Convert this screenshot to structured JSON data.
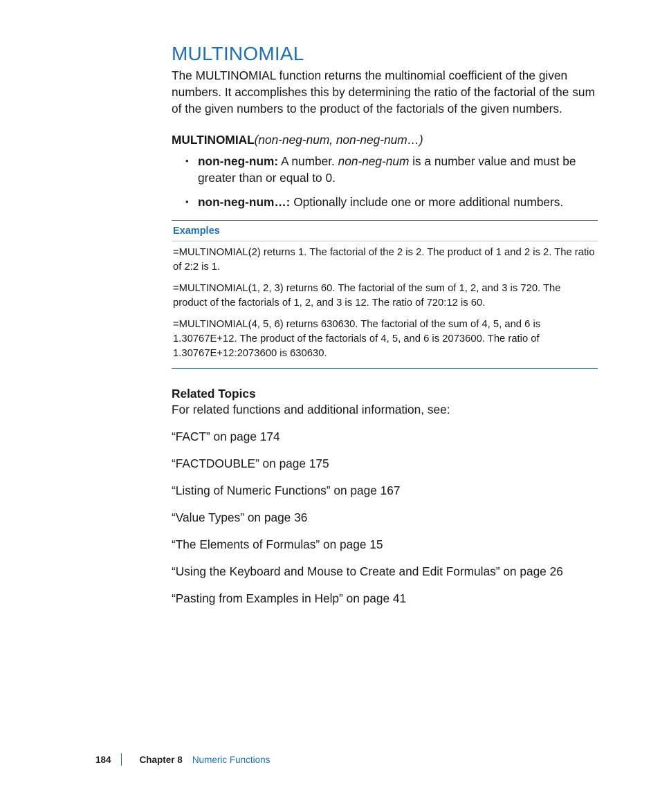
{
  "title": "MULTINOMIAL",
  "intro": "The MULTINOMIAL function returns the multinomial coefficient of the given numbers. It accomplishes this by determining the ratio of the factorial of the sum of the given numbers to the product of the factorials of the given numbers.",
  "syntax": {
    "func_name": "MULTINOMIAL",
    "args": "(non-neg-num, non-neg-num…)"
  },
  "params": [
    {
      "name": "non-neg-num:",
      "text_before_ital": "  A number. ",
      "ital": "non-neg-num",
      "text_after_ital": " is a number value and must be greater than or equal to 0."
    },
    {
      "name": "non-neg-num…:",
      "text_before_ital": "  Optionally include one or more additional numbers.",
      "ital": "",
      "text_after_ital": ""
    }
  ],
  "examples_header": "Examples",
  "examples": [
    "=MULTINOMIAL(2) returns 1. The factorial of the 2 is 2. The product of 1 and 2 is 2. The ratio of 2:2 is 1.",
    "=MULTINOMIAL(1, 2, 3) returns 60. The factorial of the sum of 1, 2, and 3 is 720. The product of the factorials of 1, 2, and 3 is 12. The ratio of 720:12 is 60.",
    "=MULTINOMIAL(4, 5, 6) returns 630630. The factorial of the sum of 4, 5, and 6 is 1.30767E+12. The product of the factorials of 4, 5, and 6 is 2073600. The ratio of 1.30767E+12:2073600 is 630630."
  ],
  "related": {
    "heading": "Related Topics",
    "intro": "For related functions and additional information, see:",
    "items": [
      "“FACT” on page 174",
      "“FACTDOUBLE” on page 175",
      "“Listing of Numeric Functions” on page 167",
      "“Value Types” on page 36",
      "“The Elements of Formulas” on page 15",
      "“Using the Keyboard and Mouse to Create and Edit Formulas” on page 26",
      "“Pasting from Examples in Help” on page 41"
    ]
  },
  "footer": {
    "page_number": "184",
    "chapter_label": "Chapter 8",
    "chapter_name": "Numeric Functions"
  }
}
